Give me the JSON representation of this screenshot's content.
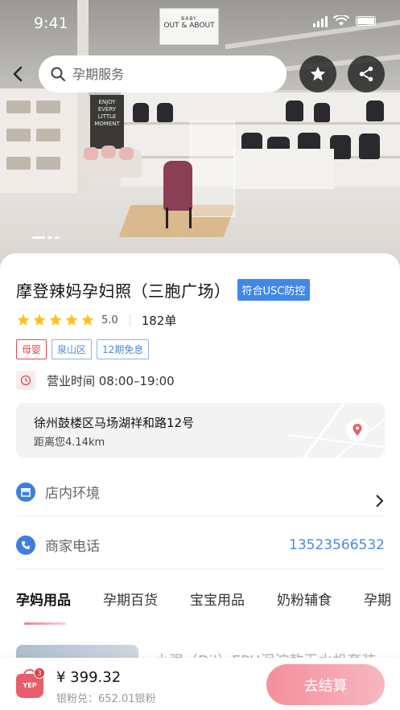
{
  "status_bar": {
    "time": "9:41"
  },
  "search": {
    "placeholder": "孕期服务"
  },
  "hero": {
    "sign_top": "BABY",
    "sign_bottom": "OUT & ABOUT",
    "wall_sign": "ENJOY EVERY LITTLE MOMENT"
  },
  "shop": {
    "title": "摩登辣妈孕妇照（三胞广场）",
    "badge": "符合USC防控",
    "rating": "5.0",
    "stars": 5,
    "orders": "182单",
    "tags": [
      "母婴",
      "泉山区",
      "12期免息"
    ],
    "hours": "营业时间 08:00–19:00",
    "address": "徐州鼓楼区马场湖祥和路12号",
    "distance": "距离您4.14km"
  },
  "rows": {
    "environment_label": "店内环境",
    "phone_label": "商家电话",
    "phone_value": "13523566532"
  },
  "tabs": [
    "孕妈用品",
    "孕期百货",
    "宝宝用品",
    "奶粉辅食",
    "孕期"
  ],
  "product_peek": {
    "title": "小强（Dil）EPU泥泞款无水机套装"
  },
  "bottom": {
    "cart_count": "3",
    "cart_label": "YEP",
    "price": "¥ 399.32",
    "credit": "银粉兑：652.01银粉",
    "checkout": "去结算"
  },
  "colors": {
    "accent_blue": "#4287e8",
    "accent_pink": "#f58f9c",
    "tag_red": "#e2484f",
    "star": "#f8c51c"
  },
  "icons": [
    "back-arrow-icon",
    "search-icon",
    "star-icon",
    "share-icon",
    "clock-icon",
    "location-pin-icon",
    "store-icon",
    "phone-icon",
    "chevron-right-icon",
    "shopping-bag-icon"
  ]
}
